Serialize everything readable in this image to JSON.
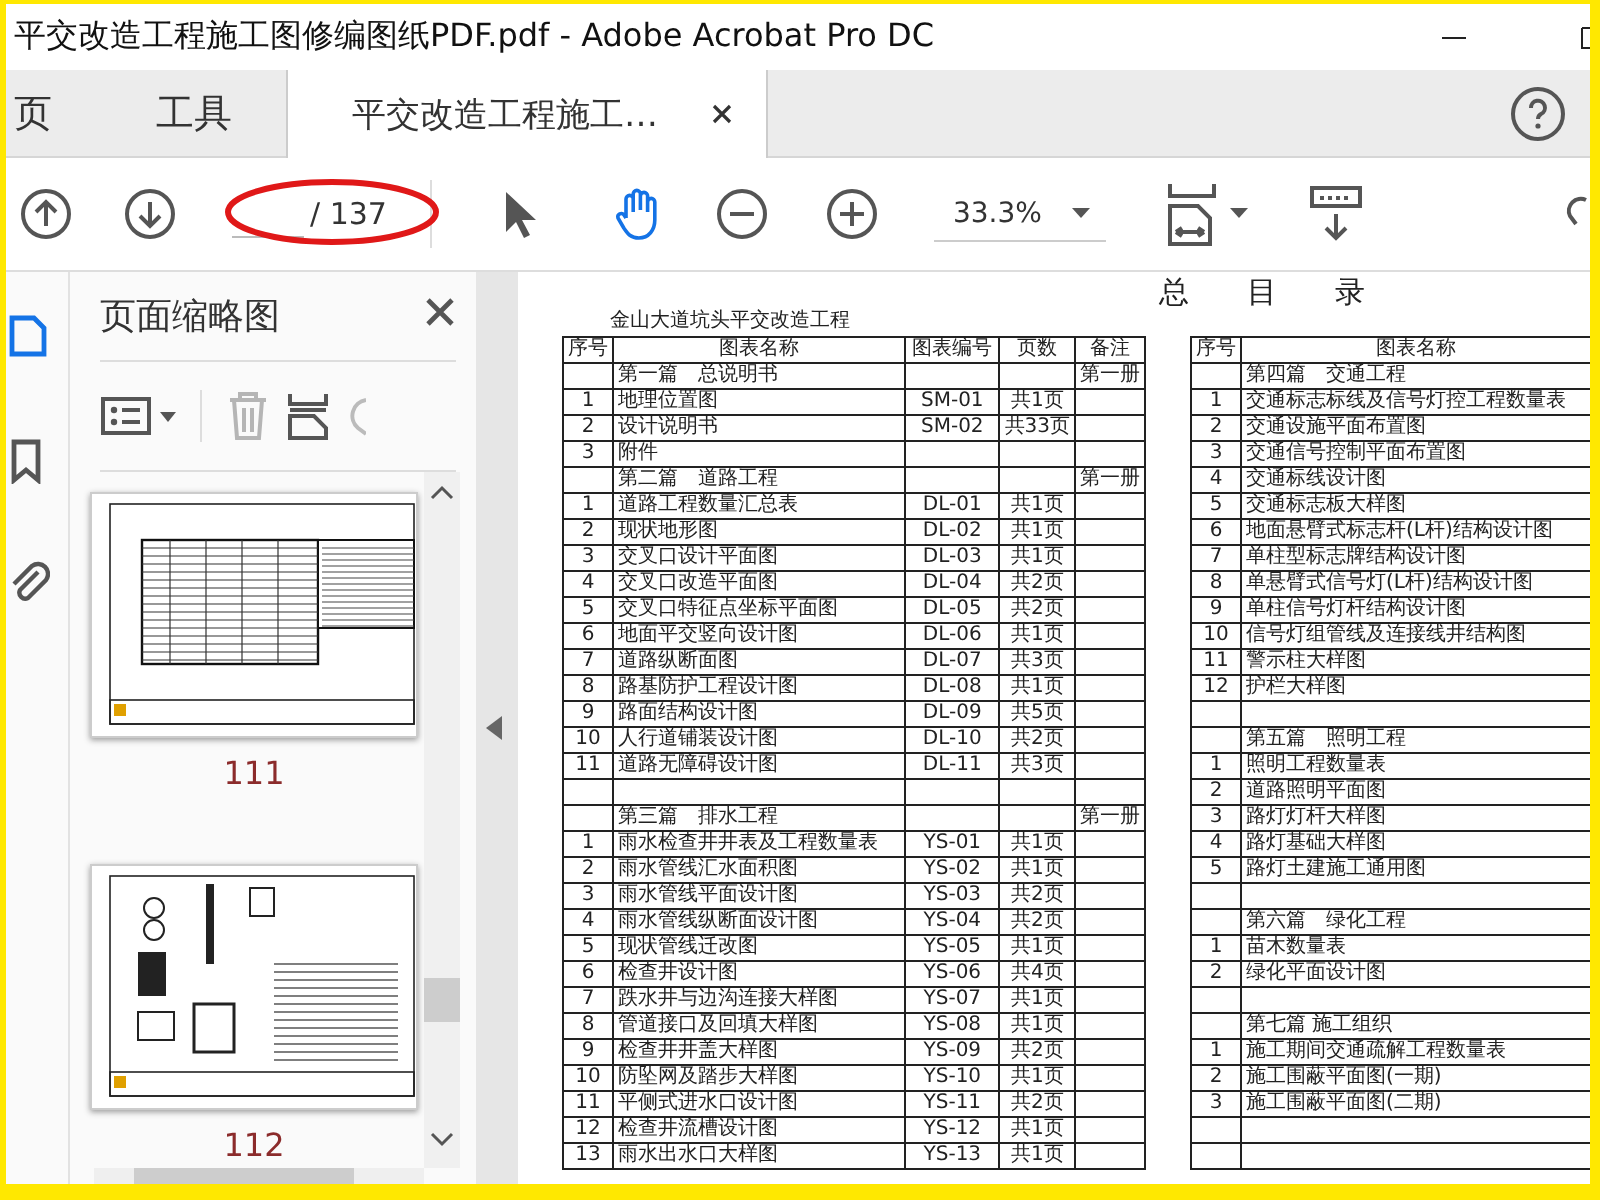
{
  "window": {
    "title": "平交改造工程施工图修编图纸PDF.pdf - Adobe Acrobat Pro DC"
  },
  "tabs": [
    {
      "label": "页",
      "selected": false,
      "closable": false
    },
    {
      "label": "工具",
      "selected": false,
      "closable": false
    },
    {
      "label": "平交改造工程施工…",
      "selected": true,
      "closable": true
    }
  ],
  "toolbar": {
    "page_total": "/ 137",
    "zoom": "33.3%"
  },
  "nav_buttons": [
    {
      "kind": "thumbnails",
      "selected": true
    },
    {
      "kind": "bookmarks",
      "selected": false
    },
    {
      "kind": "attachments",
      "selected": false
    }
  ],
  "thumbnails_panel": {
    "title": "页面缩略图",
    "pages": [
      {
        "label": "111",
        "kind": "table"
      },
      {
        "label": "112",
        "kind": "drawing"
      }
    ]
  },
  "document": {
    "heading": "总 目 录",
    "subtitle": "金山大道坑头平交改造工程",
    "tables": [
      {
        "columns": [
          "序号",
          "图表名称",
          "图表编号",
          "页数",
          "备注"
        ],
        "rows": [
          {
            "name": "第一篇　总说明书",
            "note": "第一册"
          },
          {
            "no": "1",
            "name": "地理位置图",
            "code": "SM-01",
            "pages": "共1页"
          },
          {
            "no": "2",
            "name": "设计说明书",
            "code": "SM-02",
            "pages": "共33页"
          },
          {
            "no": "3",
            "name": "附件"
          },
          {
            "name": "第二篇　道路工程",
            "note": "第一册"
          },
          {
            "no": "1",
            "name": "道路工程数量汇总表",
            "code": "DL-01",
            "pages": "共1页"
          },
          {
            "no": "2",
            "name": "现状地形图",
            "code": "DL-02",
            "pages": "共1页"
          },
          {
            "no": "3",
            "name": "交叉口设计平面图",
            "code": "DL-03",
            "pages": "共1页"
          },
          {
            "no": "4",
            "name": "交叉口改造平面图",
            "code": "DL-04",
            "pages": "共2页"
          },
          {
            "no": "5",
            "name": "交叉口特征点坐标平面图",
            "code": "DL-05",
            "pages": "共2页"
          },
          {
            "no": "6",
            "name": "地面平交竖向设计图",
            "code": "DL-06",
            "pages": "共1页"
          },
          {
            "no": "7",
            "name": "道路纵断面图",
            "code": "DL-07",
            "pages": "共3页"
          },
          {
            "no": "8",
            "name": "路基防护工程设计图",
            "code": "DL-08",
            "pages": "共1页"
          },
          {
            "no": "9",
            "name": "路面结构设计图",
            "code": "DL-09",
            "pages": "共5页"
          },
          {
            "no": "10",
            "name": "人行道铺装设计图",
            "code": "DL-10",
            "pages": "共2页"
          },
          {
            "no": "11",
            "name": "道路无障碍设计图",
            "code": "DL-11",
            "pages": "共3页"
          },
          {},
          {
            "name": "第三篇　排水工程",
            "note": "第一册"
          },
          {
            "no": "1",
            "name": "雨水检查井井表及工程数量表",
            "code": "YS-01",
            "pages": "共1页"
          },
          {
            "no": "2",
            "name": "雨水管线汇水面积图",
            "code": "YS-02",
            "pages": "共1页"
          },
          {
            "no": "3",
            "name": "雨水管线平面设计图",
            "code": "YS-03",
            "pages": "共2页"
          },
          {
            "no": "4",
            "name": "雨水管线纵断面设计图",
            "code": "YS-04",
            "pages": "共2页"
          },
          {
            "no": "5",
            "name": "现状管线迁改图",
            "code": "YS-05",
            "pages": "共1页"
          },
          {
            "no": "6",
            "name": "检查井设计图",
            "code": "YS-06",
            "pages": "共4页"
          },
          {
            "no": "7",
            "name": "跌水井与边沟连接大样图",
            "code": "YS-07",
            "pages": "共1页"
          },
          {
            "no": "8",
            "name": "管道接口及回填大样图",
            "code": "YS-08",
            "pages": "共1页"
          },
          {
            "no": "9",
            "name": "检查井井盖大样图",
            "code": "YS-09",
            "pages": "共2页"
          },
          {
            "no": "10",
            "name": "防坠网及踏步大样图",
            "code": "YS-10",
            "pages": "共1页"
          },
          {
            "no": "11",
            "name": "平侧式进水口设计图",
            "code": "YS-11",
            "pages": "共2页"
          },
          {
            "no": "12",
            "name": "检查井流槽设计图",
            "code": "YS-12",
            "pages": "共1页"
          },
          {
            "no": "13",
            "name": "雨水出水口大样图",
            "code": "YS-13",
            "pages": "共1页"
          }
        ]
      },
      {
        "columns": [
          "序号",
          "图表名称"
        ],
        "rows": [
          {
            "name": "第四篇　交通工程"
          },
          {
            "no": "1",
            "name": "交通标志标线及信号灯控工程数量表"
          },
          {
            "no": "2",
            "name": "交通设施平面布置图"
          },
          {
            "no": "3",
            "name": "交通信号控制平面布置图"
          },
          {
            "no": "4",
            "name": "交通标线设计图"
          },
          {
            "no": "5",
            "name": "交通标志板大样图"
          },
          {
            "no": "6",
            "name": "地面悬臂式标志杆(L杆)结构设计图"
          },
          {
            "no": "7",
            "name": "单柱型标志牌结构设计图"
          },
          {
            "no": "8",
            "name": "单悬臂式信号灯(L杆)结构设计图"
          },
          {
            "no": "9",
            "name": "单柱信号灯杆结构设计图"
          },
          {
            "no": "10",
            "name": "信号灯组管线及连接线井结构图"
          },
          {
            "no": "11",
            "name": "警示柱大样图"
          },
          {
            "no": "12",
            "name": "护栏大样图"
          },
          {},
          {
            "name": "第五篇　照明工程"
          },
          {
            "no": "1",
            "name": "照明工程数量表"
          },
          {
            "no": "2",
            "name": "道路照明平面图"
          },
          {
            "no": "3",
            "name": "路灯灯杆大样图"
          },
          {
            "no": "4",
            "name": "路灯基础大样图"
          },
          {
            "no": "5",
            "name": "路灯土建施工通用图"
          },
          {},
          {
            "name": "第六篇　绿化工程"
          },
          {
            "no": "1",
            "name": "苗木数量表"
          },
          {
            "no": "2",
            "name": "绿化平面设计图"
          },
          {},
          {
            "name": "第七篇 施工组织"
          },
          {
            "no": "1",
            "name": "施工期间交通疏解工程数量表"
          },
          {
            "no": "2",
            "name": "施工围蔽平面图(一期)"
          },
          {
            "no": "3",
            "name": "施工围蔽平面图(二期)"
          },
          {},
          {}
        ]
      }
    ]
  }
}
